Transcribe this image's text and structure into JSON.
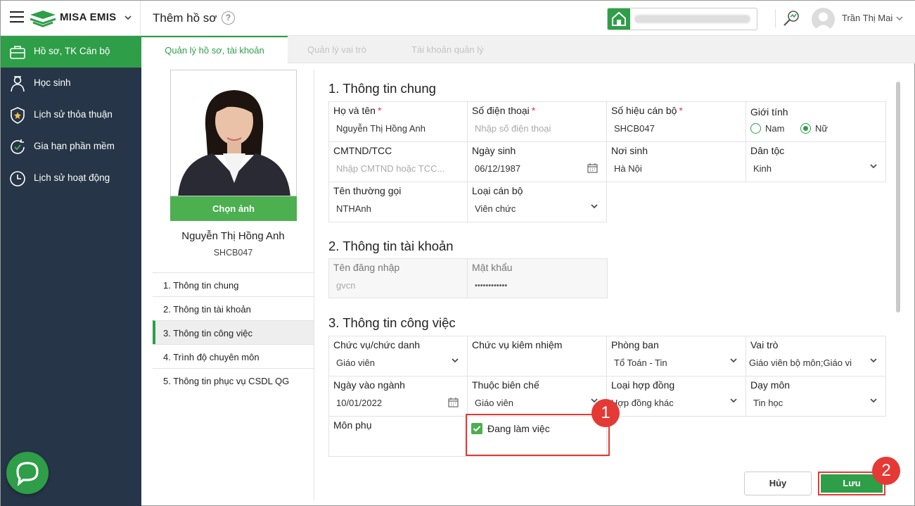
{
  "header": {
    "brand": "MISA EMIS",
    "page_title": "Thêm hồ sơ",
    "help": "?",
    "user_name": "Trần Thị Mai"
  },
  "sidebar": {
    "items": [
      {
        "label": "Hồ sơ, TK Cán bộ",
        "icon": "briefcase-icon",
        "active": true
      },
      {
        "label": "Học sinh",
        "icon": "student-icon"
      },
      {
        "label": "Lịch sử thỏa thuận",
        "icon": "shield-star-icon"
      },
      {
        "label": "Gia hạn phần mềm",
        "icon": "renew-check-icon"
      },
      {
        "label": "Lịch sử hoạt động",
        "icon": "clock-icon"
      }
    ]
  },
  "tabs": [
    "Quản lý hồ sơ, tài khoản",
    "Quản lý vai trò",
    "Tài khoản quản lý"
  ],
  "profile": {
    "choose_photo": "Chọn ảnh",
    "name": "Nguyễn Thị Hồng Anh",
    "code": "SHCB047",
    "sections": [
      "1. Thông tin chung",
      "2. Thông tin tài khoản",
      "3. Thông tin công việc",
      "4. Trình độ chuyên môn",
      "5. Thông tin phục vụ CSDL QG"
    ]
  },
  "general": {
    "title": "1. Thông tin chung",
    "full_name": {
      "label": "Họ và tên",
      "req": "*",
      "value": "Nguyễn Thị Hồng Anh"
    },
    "phone": {
      "label": "Số điện thoại",
      "req": "*",
      "placeholder": "Nhập số điện thoại"
    },
    "staff_code": {
      "label": "Số hiệu cán bộ",
      "req": "*",
      "value": "SHCB047"
    },
    "gender": {
      "label": "Giới tính",
      "options": [
        "Nam",
        "Nữ"
      ],
      "selected": "Nữ"
    },
    "id_card": {
      "label": "CMTND/TCC",
      "placeholder": "Nhập CMTND hoặc TCC..."
    },
    "dob": {
      "label": "Ngày sinh",
      "value": "06/12/1987"
    },
    "birthplace": {
      "label": "Nơi sinh",
      "value": "Hà Nội"
    },
    "ethnicity": {
      "label": "Dân tộc",
      "value": "Kinh"
    },
    "nickname": {
      "label": "Tên thường gọi",
      "value": "NTHAnh"
    },
    "staff_type": {
      "label": "Loại cán bộ",
      "value": "Viên chức"
    }
  },
  "account": {
    "title": "2. Thông tin tài khoản",
    "username": {
      "label": "Tên đăng nhập",
      "value": "gvcn"
    },
    "password": {
      "label": "Mật khẩu",
      "value": "••••••••••••"
    }
  },
  "job": {
    "title": "3. Thông tin công việc",
    "position": {
      "label": "Chức vụ/chức danh",
      "value": "Giáo viên"
    },
    "concurrent": {
      "label": "Chức vụ kiêm nhiệm",
      "value": ""
    },
    "department": {
      "label": "Phòng ban",
      "value": "Tổ Toán - Tin"
    },
    "role": {
      "label": "Vai trò",
      "value": "Giáo viên bộ môn;Giáo vi"
    },
    "start_date": {
      "label": "Ngày vào ngành",
      "value": "10/01/2022"
    },
    "payroll": {
      "label": "Thuộc biên chế",
      "value": "Giáo viên"
    },
    "contract": {
      "label": "Loại hợp đồng",
      "value": "Hợp đồng khác"
    },
    "subject": {
      "label": "Dạy môn",
      "value": "Tin học"
    },
    "sub_subject": {
      "label": "Môn phụ",
      "value": ""
    },
    "working": {
      "label": "Đang làm việc",
      "checked": true
    }
  },
  "actions": {
    "cancel": "Hủy",
    "save": "Lưu"
  },
  "badges": [
    "1",
    "2"
  ],
  "colors": {
    "green": "#2e9e48",
    "sidebar": "#263547",
    "highlight": "#e53935"
  }
}
